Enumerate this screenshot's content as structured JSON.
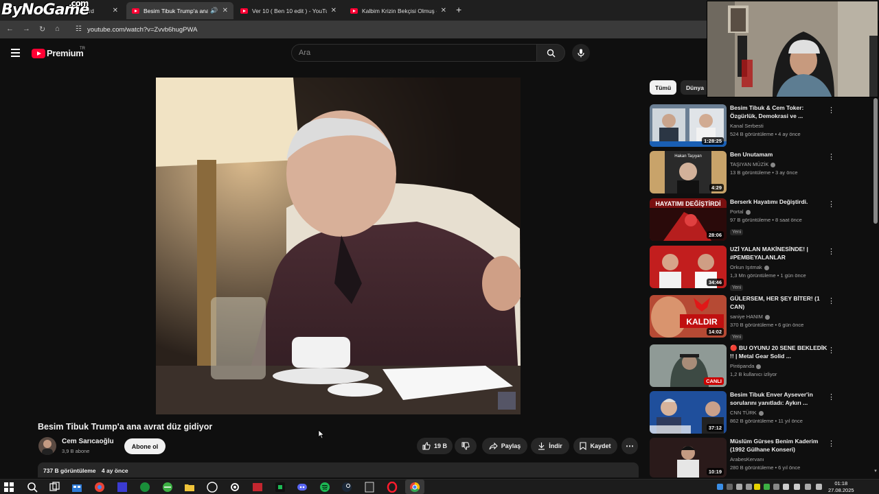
{
  "browser": {
    "tabs": [
      {
        "label": "...board",
        "active": false
      },
      {
        "label": "Besim Tibuk Trump'a ana av...",
        "active": true
      },
      {
        "label": "Ver 10 ( Ben 10 edit ) - YouTube",
        "active": false
      },
      {
        "label": "Kalbim Krizin Bekçisi Olmuş - Yo...",
        "active": false
      }
    ],
    "url": "youtube.com/watch?v=Zvvb6hugPWA",
    "overlay_logo": "ByNoGame",
    "overlay_logo_suffix": ".com"
  },
  "header": {
    "brand": "Premium",
    "region": "TR",
    "search_placeholder": "Ara"
  },
  "video": {
    "title": "Besim Tibuk Trump'a ana avrat düz gidiyor",
    "channel": "Cem Sarıcaoğlu",
    "subscribers": "3,9 B abone",
    "subscribe_label": "Abone ol",
    "likes": "19 B",
    "share_label": "Paylaş",
    "download_label": "İndir",
    "save_label": "Kaydet",
    "views": "737 B görüntüleme",
    "age": "4 ay önce"
  },
  "sidebar": {
    "chips": [
      "Tümü",
      "Dünya"
    ],
    "recommendations": [
      {
        "title": "Besim Tibuk & Cem Toker: Özgürlük, Demokrasi ve ...",
        "channel": "Kanal Serbesti",
        "meta": "524 B görüntüleme • 4 ay önce",
        "duration": "1:28:25",
        "badge": "",
        "verified": false
      },
      {
        "title": "Ben Unutamam",
        "channel": "TAŞIYAN MÜZİK",
        "meta": "13 B görüntüleme • 3 ay önce",
        "duration": "4:29",
        "badge": "",
        "verified": true,
        "thumb_text": "Hakan Taşıyan"
      },
      {
        "title": "Berserk Hayatımı Değiştirdi.",
        "channel": "Portal",
        "meta": "97 B görüntüleme • 8 saat önce",
        "duration": "28:06",
        "badge": "Yeni",
        "verified": true,
        "thumb_text": "HAYATIMI DEĞİŞTİRDİ"
      },
      {
        "title": "UZİ YALAN MAKİNESİNDE! | #PEMBEYALANLAR",
        "channel": "Orkun Işıtmak",
        "meta": "1,3 Mn görüntüleme • 1 gün önce",
        "duration": "34:46",
        "badge": "Yeni",
        "verified": true
      },
      {
        "title": "GÜLERSEM, HER ŞEY BİTER! (1 CAN)",
        "channel": "saniye HANIM",
        "meta": "370 B görüntüleme • 6 gün önce",
        "duration": "14:02",
        "badge": "Yeni",
        "verified": true,
        "thumb_text": "KALDIR"
      },
      {
        "title": "🔴 BU OYUNU 20 SENE BEKLEDİK !! | Metal Gear Solid ...",
        "channel": "Pintipanda",
        "meta": "1,2 B kullanıcı izliyor",
        "duration": "",
        "badge": "",
        "verified": true,
        "live": "CANLI"
      },
      {
        "title": "Besim Tibuk Enver Aysever'in sorularını yanıtladı: Aykırı ...",
        "channel": "CNN TÜRK",
        "meta": "862 B görüntüleme • 11 yıl önce",
        "duration": "37:12",
        "badge": "",
        "verified": true
      },
      {
        "title": "Müslüm Gürses Benim Kaderim (1992 Gülhane Konseri)",
        "channel": "ArabesKervanı",
        "meta": "280 B görüntüleme • 6 yıl önce",
        "duration": "10:19",
        "badge": "",
        "verified": false
      }
    ]
  },
  "taskbar": {
    "time": "01:18",
    "date": "27.08.2025"
  }
}
